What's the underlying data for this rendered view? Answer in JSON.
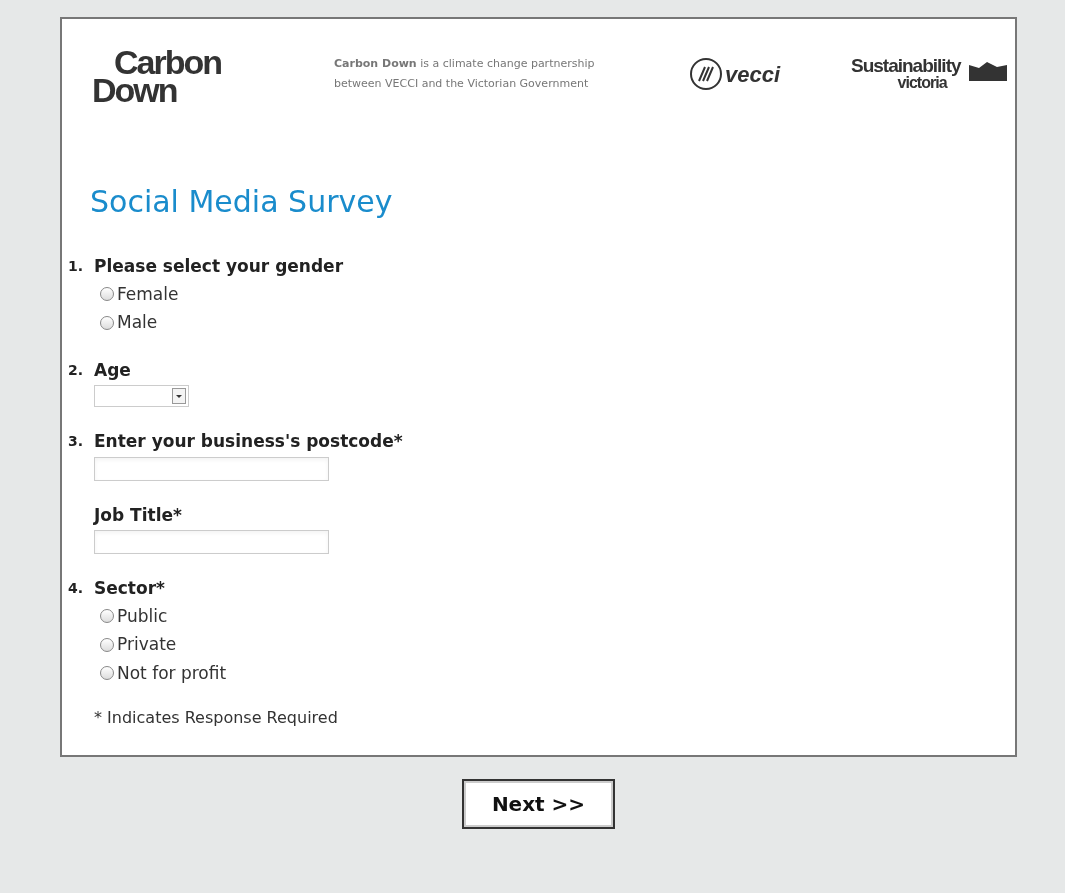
{
  "header": {
    "logo_top": "Carbon",
    "logo_bottom": "Down",
    "tagline": "**Carbon Down** is a climate change partnership between VECCI and the Victorian Government",
    "partner_1": "vecci",
    "partner_2_top": "Sustainability",
    "partner_2_bottom": "victoria"
  },
  "title": "Social Media Survey",
  "questions": [
    {
      "kind": "radio",
      "number": "1.",
      "label": "Please select your gender",
      "options": [
        {
          "label": "Female",
          "selected": false
        },
        {
          "label": "Male",
          "selected": false
        }
      ]
    },
    {
      "kind": "select",
      "number": "2.",
      "label": "Age"
    },
    {
      "kind": "text",
      "number": "3.",
      "label": "Enter your business's postcode*"
    },
    {
      "kind": "text",
      "label": "Job Title*"
    },
    {
      "kind": "radio",
      "number": "4.",
      "label": "Sector*",
      "options": [
        {
          "label": "Public",
          "selected": false
        },
        {
          "label": "Private",
          "selected": false
        },
        {
          "label": "Not for profit",
          "selected": false
        }
      ]
    }
  ],
  "footnote": "* Indicates Response Required",
  "next_button": "Next >>"
}
